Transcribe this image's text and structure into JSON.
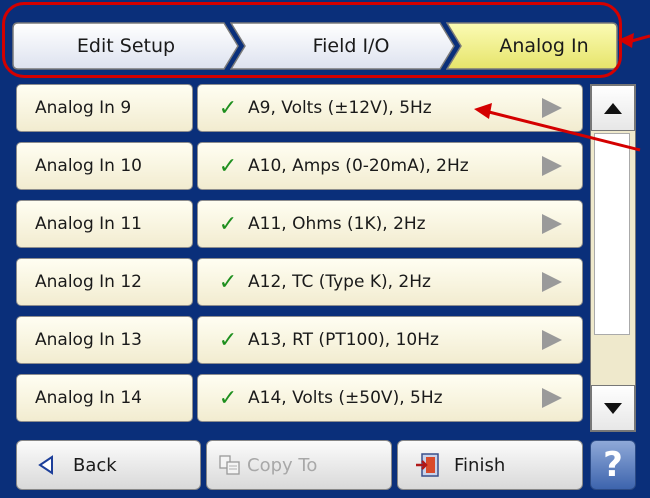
{
  "breadcrumb": [
    {
      "label": "Edit Setup"
    },
    {
      "label": "Field I/O"
    },
    {
      "label": "Analog In"
    }
  ],
  "rows": [
    {
      "name": "Analog In 9",
      "value": "A9, Volts (±12V), 5Hz"
    },
    {
      "name": "Analog In 10",
      "value": "A10, Amps (0-20mA), 2Hz"
    },
    {
      "name": "Analog In 11",
      "value": "A11, Ohms (1K), 2Hz"
    },
    {
      "name": "Analog In 12",
      "value": "A12, TC (Type K), 2Hz"
    },
    {
      "name": "Analog In 13",
      "value": "A13, RT (PT100), 10Hz"
    },
    {
      "name": "Analog In 14",
      "value": "A14, Volts (±50V), 5Hz"
    }
  ],
  "footer": {
    "back_label": "Back",
    "copy_label": "Copy To",
    "finish_label": "Finish",
    "help_label": "?"
  },
  "icons": {
    "check": "checkmark-icon",
    "row_arrow": "play-arrow-icon",
    "back": "left-triangle-icon",
    "copy": "copy-icon",
    "finish": "exit-door-icon",
    "help": "question-mark-icon"
  },
  "colors": {
    "frame": "#0a2f7a",
    "active_tab": "#f0ef8e",
    "row_bg": "#f6f0d6",
    "check": "#1e8f1e",
    "annotation": "#d40000",
    "help_button": "#3d64ad"
  }
}
